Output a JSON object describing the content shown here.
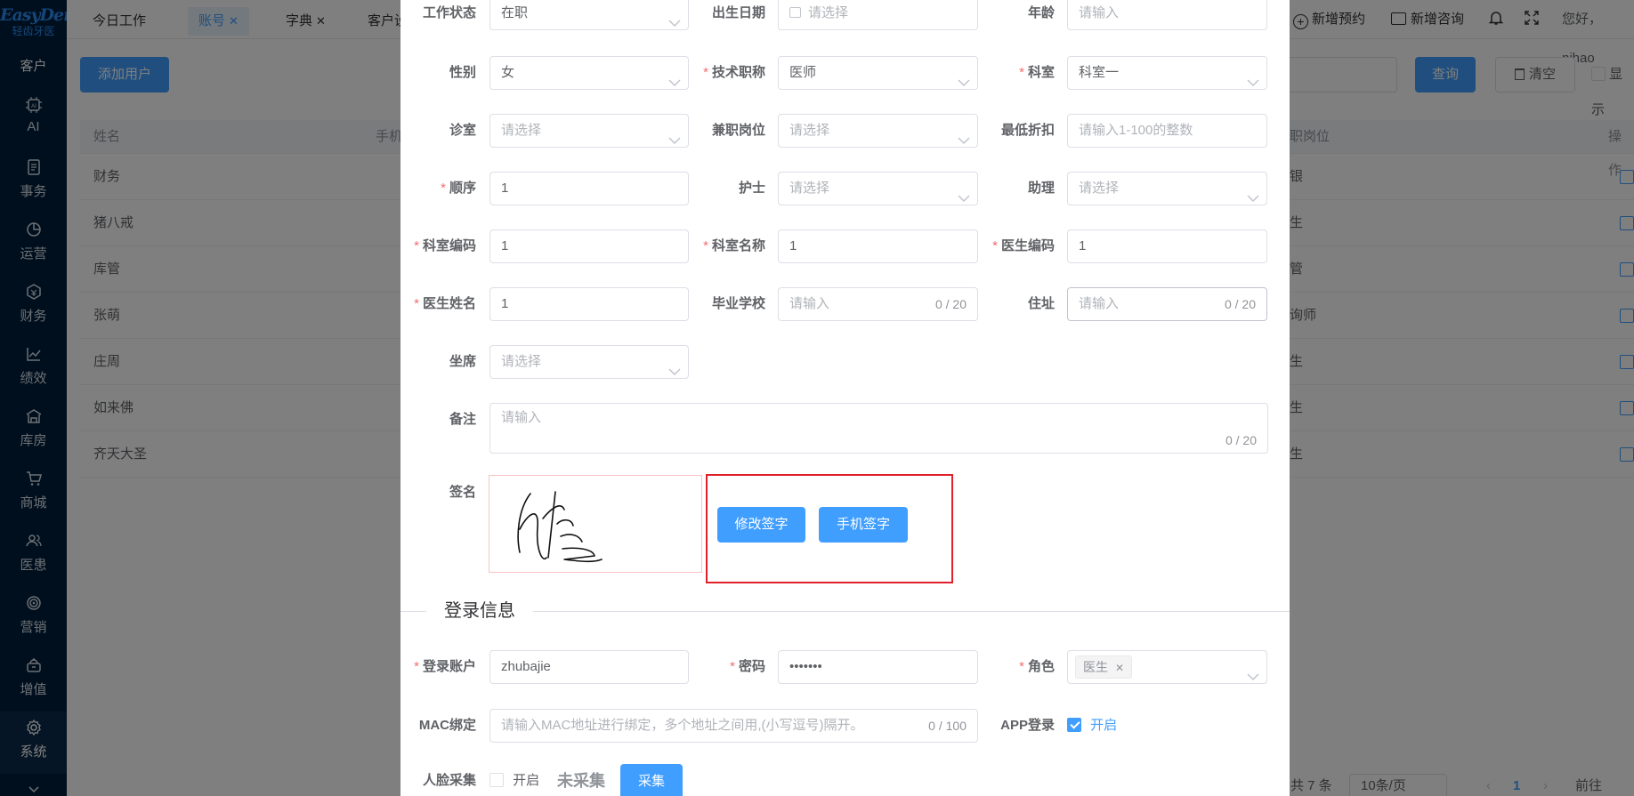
{
  "brand": {
    "name": "EasyDent",
    "sub": "轻齿牙医"
  },
  "sidebar": {
    "top_label": "客户",
    "items": [
      {
        "label": "AI",
        "icon": "ai-icon"
      },
      {
        "label": "事务",
        "icon": "document-icon"
      },
      {
        "label": "运营",
        "icon": "pie-chart-icon"
      },
      {
        "label": "财务",
        "icon": "money-icon"
      },
      {
        "label": "绩效",
        "icon": "trend-icon"
      },
      {
        "label": "库房",
        "icon": "warehouse-icon"
      },
      {
        "label": "商城",
        "icon": "cart-icon"
      },
      {
        "label": "医患",
        "icon": "users-icon"
      },
      {
        "label": "营销",
        "icon": "target-icon"
      },
      {
        "label": "增值",
        "icon": "gift-icon"
      },
      {
        "label": "系统",
        "icon": "gear-icon"
      }
    ]
  },
  "topbar": {
    "tabs": [
      {
        "label": "今日工作",
        "closable": false
      },
      {
        "label": "账号",
        "closable": true
      },
      {
        "label": "字典",
        "closable": true
      },
      {
        "label": "客户设",
        "closable": false
      }
    ],
    "new_appointment": "新增预约",
    "new_consult": "新增咨询",
    "greeting": "您好，nihao"
  },
  "page": {
    "add_user": "添加用户",
    "query": "查询",
    "clear": "清空",
    "show_label": "显示",
    "table": {
      "headers": [
        "姓名",
        "手机",
        "职岗位",
        "操作"
      ],
      "rows": [
        {
          "name": "财务",
          "post": "银"
        },
        {
          "name": "猪八戒",
          "post": "生"
        },
        {
          "name": "库管",
          "post": "管"
        },
        {
          "name": "张萌",
          "post": "询师"
        },
        {
          "name": "庄周",
          "post": "生"
        },
        {
          "name": "如来佛",
          "post": "生"
        },
        {
          "name": "齐天大圣",
          "post": "生"
        }
      ]
    },
    "pager": {
      "total": "共 7 条",
      "page_size": "10条/页",
      "current": "1",
      "goto": "前往"
    }
  },
  "form": {
    "work_status": {
      "label": "工作状态",
      "value": "在职"
    },
    "birth_date": {
      "label": "出生日期",
      "placeholder": "请选择"
    },
    "age": {
      "label": "年龄",
      "placeholder": "请输入"
    },
    "gender": {
      "label": "性别",
      "value": "女"
    },
    "tech_title": {
      "label": "技术职称",
      "value": "医师"
    },
    "department": {
      "label": "科室",
      "value": "科室一"
    },
    "clinic_room": {
      "label": "诊室",
      "placeholder": "请选择"
    },
    "part_time_post": {
      "label": "兼职岗位",
      "placeholder": "请选择"
    },
    "min_discount": {
      "label": "最低折扣",
      "placeholder": "请输入1-100的整数"
    },
    "order": {
      "label": "顺序",
      "value": "1"
    },
    "nurse": {
      "label": "护士",
      "placeholder": "请选择"
    },
    "assistant": {
      "label": "助理",
      "placeholder": "请选择"
    },
    "dept_code": {
      "label": "科室编码",
      "value": "1"
    },
    "dept_name": {
      "label": "科室名称",
      "value": "1"
    },
    "doctor_code": {
      "label": "医生编码",
      "value": "1"
    },
    "doctor_name": {
      "label": "医生姓名",
      "value": "1"
    },
    "school": {
      "label": "毕业学校",
      "placeholder": "请输入",
      "count": "0 / 20"
    },
    "address": {
      "label": "住址",
      "placeholder": "请输入",
      "count": "0 / 20"
    },
    "seat": {
      "label": "坐席",
      "placeholder": "请选择"
    },
    "remark": {
      "label": "备注",
      "placeholder": "请输入",
      "count": "0 / 20"
    },
    "signature": {
      "label": "签名",
      "modify_btn": "修改签字",
      "phone_btn": "手机签字"
    },
    "login_section": "登录信息",
    "login_account": {
      "label": "登录账户",
      "value": "zhubajie"
    },
    "password": {
      "label": "密码",
      "value": "•••••••"
    },
    "role": {
      "label": "角色",
      "tag": "医生"
    },
    "mac": {
      "label": "MAC绑定",
      "placeholder": "请输入MAC地址进行绑定，多个地址之间用,(小写逗号)隔开。",
      "count": "0 / 100"
    },
    "app_login": {
      "label": "APP登录",
      "option": "开启",
      "checked": true
    },
    "face": {
      "label": "人脸采集",
      "option": "开启",
      "status": "未采集",
      "collect_btn": "采集",
      "checked": false
    }
  },
  "colors": {
    "primary": "#409eff",
    "required": "#f56c6c",
    "sidebar": "#001e3c",
    "highlight": "#e0202a"
  }
}
